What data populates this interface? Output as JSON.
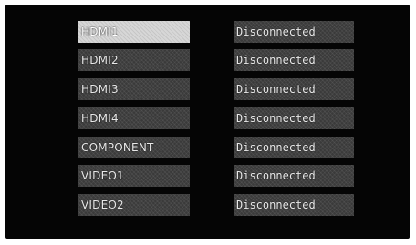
{
  "inputs": [
    {
      "label": "HDMI1",
      "status": "Disconnected",
      "selected": true
    },
    {
      "label": "HDMI2",
      "status": "Disconnected",
      "selected": false
    },
    {
      "label": "HDMI3",
      "status": "Disconnected",
      "selected": false
    },
    {
      "label": "HDMI4",
      "status": "Disconnected",
      "selected": false
    },
    {
      "label": "COMPONENT",
      "status": "Disconnected",
      "selected": false
    },
    {
      "label": "VIDEO1",
      "status": "Disconnected",
      "selected": false
    },
    {
      "label": "VIDEO2",
      "status": "Disconnected",
      "selected": false
    }
  ]
}
